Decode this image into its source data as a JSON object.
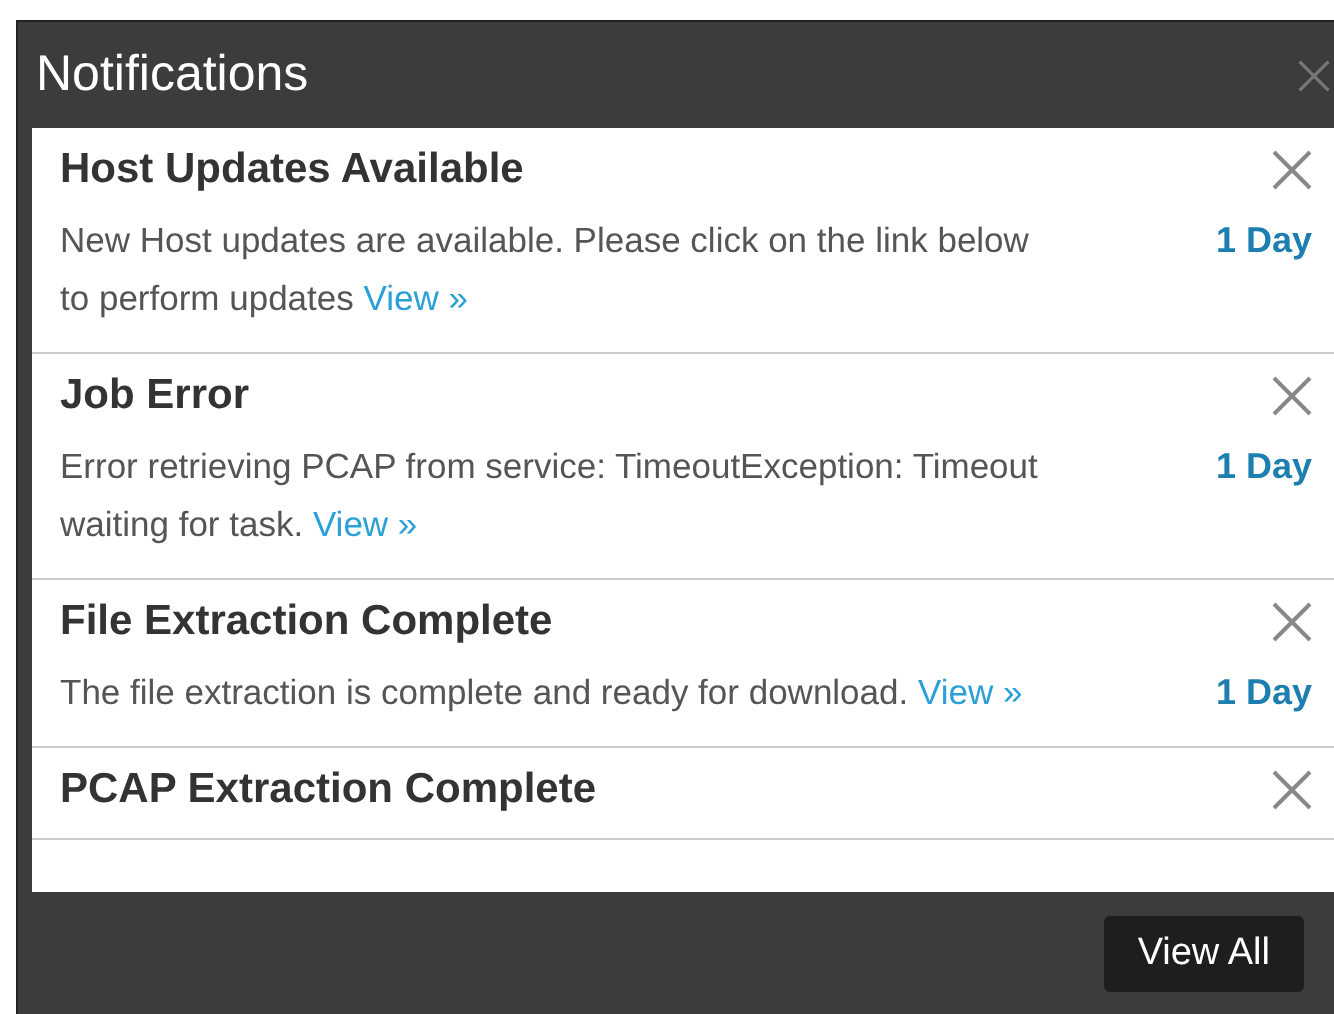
{
  "panel": {
    "title": "Notifications"
  },
  "notifications": [
    {
      "title": "Host Updates Available",
      "message": "New Host updates are available. Please click on the link below to perform updates",
      "link": "View »",
      "age": "1 Day"
    },
    {
      "title": "Job Error",
      "message": "Error retrieving PCAP from service: TimeoutException: Timeout waiting for task.",
      "link": "View »",
      "age": "1 Day"
    },
    {
      "title": "File Extraction Complete",
      "message": "The file extraction is complete and ready for download.",
      "link": "View »",
      "age": "1 Day"
    },
    {
      "title": "PCAP Extraction Complete"
    }
  ],
  "footer": {
    "button": "View All"
  }
}
